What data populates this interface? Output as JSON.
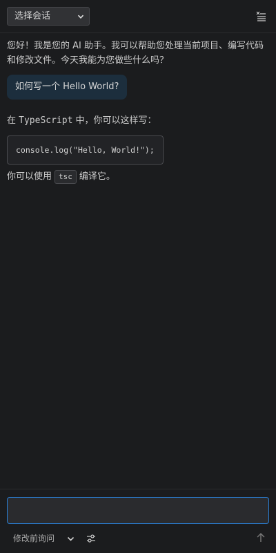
{
  "header": {
    "session_select": "选择会话",
    "clear_icon": "clear-all-icon"
  },
  "messages": {
    "assistant_greeting": "您好！我是您的 AI 助手。我可以帮助您处理当前项目、编写代码和修改文件。今天我能为您做些什么吗？",
    "user_question": "如何写一个 Hello World?",
    "reply_intro_before": "在 ",
    "reply_intro_lang": "TypeScript",
    "reply_intro_after": " 中，你可以这样写：",
    "code_snippet": "console.log(\"Hello, World!\");",
    "reply_outro_before": "你可以使用",
    "reply_outro_code": "tsc",
    "reply_outro_after": "编译它。"
  },
  "footer": {
    "input_value": "",
    "input_placeholder": "",
    "mode_select": "修改前询问",
    "settings_icon": "settings-sliders-icon",
    "send_icon": "arrow-up-icon"
  },
  "colors": {
    "background": "#1b1c1e",
    "user_bubble": "#1c2e3d",
    "input_focus_border": "#2a7fd4"
  }
}
